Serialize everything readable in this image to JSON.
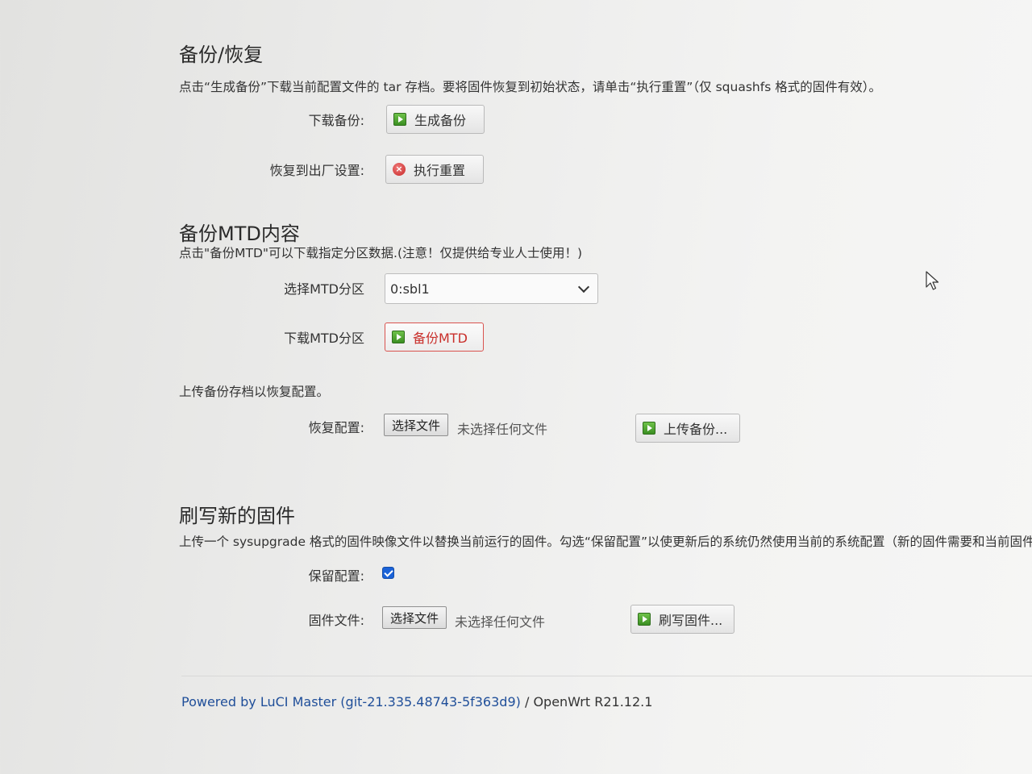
{
  "backup": {
    "title": "备份/恢复",
    "description": "点击“生成备份”下载当前配置文件的 tar 存档。要将固件恢复到初始状态，请单击“执行重置”（仅 squashfs 格式的固件有效）。",
    "download_label": "下载备份:",
    "generate_button": "生成备份",
    "reset_label": "恢复到出厂设置:",
    "reset_button": "执行重置"
  },
  "mtd": {
    "title": "备份MTD内容",
    "description": "点击\"备份MTD\"可以下载指定分区数据.(注意！仅提供给专业人士使用！)",
    "select_label": "选择MTD分区",
    "selected_partition": "0:sbl1",
    "download_label": "下载MTD分区",
    "backup_button": "备份MTD"
  },
  "restore": {
    "description": "上传备份存档以恢复配置。",
    "label": "恢复配置:",
    "choose_file": "选择文件",
    "no_file": "未选择任何文件",
    "upload_button": "上传备份..."
  },
  "flash": {
    "title": "刷写新的固件",
    "description": "上传一个 sysupgrade 格式的固件映像文件以替换当前运行的固件。勾选“保留配置”以使更新后的系统仍然使用当前的系统配置（新的固件需要和当前固件",
    "keep_label": "保留配置:",
    "keep_checked": true,
    "file_label": "固件文件:",
    "choose_file": "选择文件",
    "no_file": "未选择任何文件",
    "flash_button": "刷写固件..."
  },
  "footer": {
    "powered": "Powered by ",
    "luci_link": "LuCI Master (git-21.335.48743-5f363d9)",
    "separator": " / ",
    "openwrt": "OpenWrt R21.12.1"
  },
  "colors": {
    "accent_blue": "#1a62d8",
    "danger_red": "#c9302c",
    "link_blue": "#1f4e99"
  }
}
